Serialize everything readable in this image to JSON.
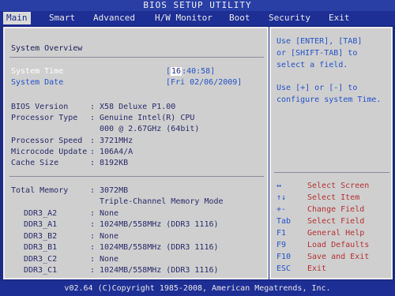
{
  "title": "BIOS SETUP UTILITY",
  "menu": [
    {
      "label": "Main"
    },
    {
      "label": "Smart"
    },
    {
      "label": "Advanced"
    },
    {
      "label": "H/W Monitor"
    },
    {
      "label": "Boot"
    },
    {
      "label": "Security"
    },
    {
      "label": "Exit"
    }
  ],
  "main": {
    "section_title": "System Overview",
    "system_time": {
      "label": "System Time",
      "value_prefix": "[",
      "value_cursor": "16",
      "value_rest": ":40:58]"
    },
    "system_date": {
      "label": "System Date",
      "value": "[Fri 02/06/2009]"
    },
    "info": [
      {
        "label": "BIOS Version",
        "sep": ":",
        "value": "X58 Deluxe P1.00"
      },
      {
        "label": "Processor Type",
        "sep": ":",
        "value": "Genuine Intel(R) CPU"
      },
      {
        "label": "",
        "sep": "",
        "value": "000  @ 2.67GHz (64bit)"
      },
      {
        "label": "Processor Speed",
        "sep": ":",
        "value": "3721MHz"
      },
      {
        "label": "Microcode Update",
        "sep": ":",
        "value": "106A4/A"
      },
      {
        "label": "Cache Size",
        "sep": ":",
        "value": "8192KB"
      }
    ],
    "memory": {
      "total_label": "Total Memory",
      "total_sep": ":",
      "total_value": "3072MB",
      "mode": "Triple-Channel Memory Mode",
      "slots": [
        {
          "label": "DDR3_A2",
          "sep": ":",
          "value": "None"
        },
        {
          "label": "DDR3_A1",
          "sep": ":",
          "value": "1024MB/558MHz (DDR3 1116)"
        },
        {
          "label": "DDR3_B2",
          "sep": ":",
          "value": "None"
        },
        {
          "label": "DDR3_B1",
          "sep": ":",
          "value": "1024MB/558MHz (DDR3 1116)"
        },
        {
          "label": "DDR3_C2",
          "sep": ":",
          "value": "None"
        },
        {
          "label": "DDR3_C1",
          "sep": ":",
          "value": "1024MB/558MHz (DDR3 1116)"
        }
      ]
    }
  },
  "help": {
    "lines": [
      "Use [ENTER], [TAB]",
      "or [SHIFT-TAB] to",
      "select a field.",
      "",
      "Use [+] or [-] to",
      "configure system Time."
    ],
    "keys": [
      {
        "key": "↔",
        "action": "Select Screen"
      },
      {
        "key": "↑↓",
        "action": "Select Item"
      },
      {
        "key": "+-",
        "action": "Change Field"
      },
      {
        "key": "Tab",
        "action": "Select Field"
      },
      {
        "key": "F1",
        "action": "General Help"
      },
      {
        "key": "F9",
        "action": "Load Defaults"
      },
      {
        "key": "F10",
        "action": "Save and Exit"
      },
      {
        "key": "ESC",
        "action": "Exit"
      }
    ]
  },
  "footer": "v02.64 (C)Copyright 1985-2008, American Megatrends, Inc."
}
